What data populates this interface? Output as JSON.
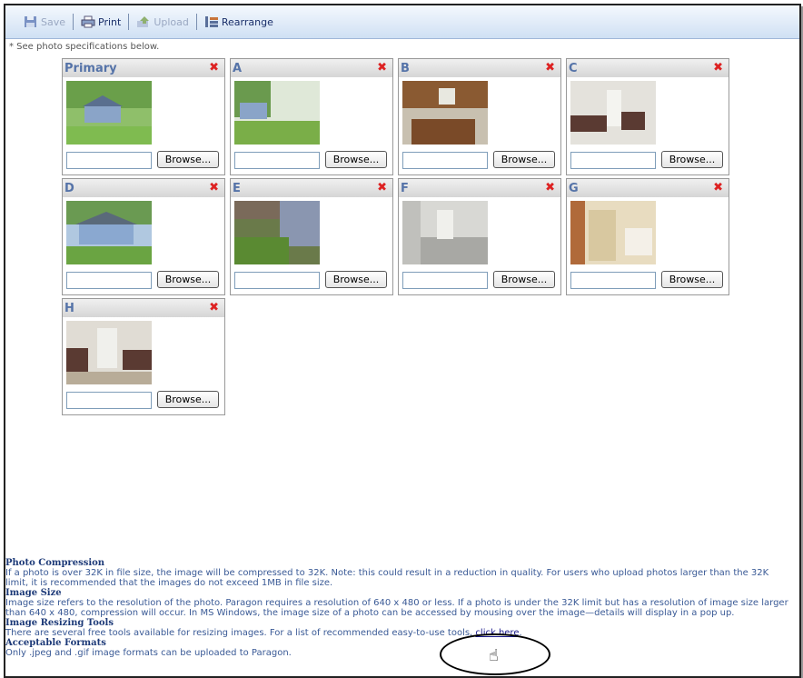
{
  "toolbar": {
    "save_label": "Save",
    "print_label": "Print",
    "upload_label": "Upload",
    "rearrange_label": "Rearrange"
  },
  "spec_note": "* See photo specifications below.",
  "slots": [
    {
      "label": "Primary",
      "browse": "Browse...",
      "remove": "✖"
    },
    {
      "label": "A",
      "browse": "Browse...",
      "remove": "✖"
    },
    {
      "label": "B",
      "browse": "Browse...",
      "remove": "✖"
    },
    {
      "label": "C",
      "browse": "Browse...",
      "remove": "✖"
    },
    {
      "label": "D",
      "browse": "Browse...",
      "remove": "✖"
    },
    {
      "label": "E",
      "browse": "Browse...",
      "remove": "✖"
    },
    {
      "label": "F",
      "browse": "Browse...",
      "remove": "✖"
    },
    {
      "label": "G",
      "browse": "Browse...",
      "remove": "✖"
    },
    {
      "label": "H",
      "browse": "Browse...",
      "remove": "✖"
    }
  ],
  "info": {
    "compression_title": "Photo Compression",
    "compression_text": "If a photo is over 32K in file size, the image will be compressed to 32K. Note: this could result in a reduction in quality. For users who upload photos larger than the 32K limit, it is recommended that the images do not exceed 1MB in file size.",
    "size_title": "Image Size",
    "size_text": "Image size refers to the resolution of the photo. Paragon requires a resolution of 640 x 480 or less. If a photo is under the 32K limit but has a resolution of image size larger than 640 x 480, compression will occur. In MS Windows, the image size of a photo can be accessed by mousing over the image—details will display in a pop up.",
    "tools_title": "Image Resizing Tools",
    "tools_text": "There are several free tools available for resizing images. For a list of recommended easy-to-use tools,",
    "tools_link": "click here",
    "formats_title": "Acceptable Formats",
    "formats_text": "Only .jpeg and .gif image formats can be uploaded to Paragon."
  }
}
